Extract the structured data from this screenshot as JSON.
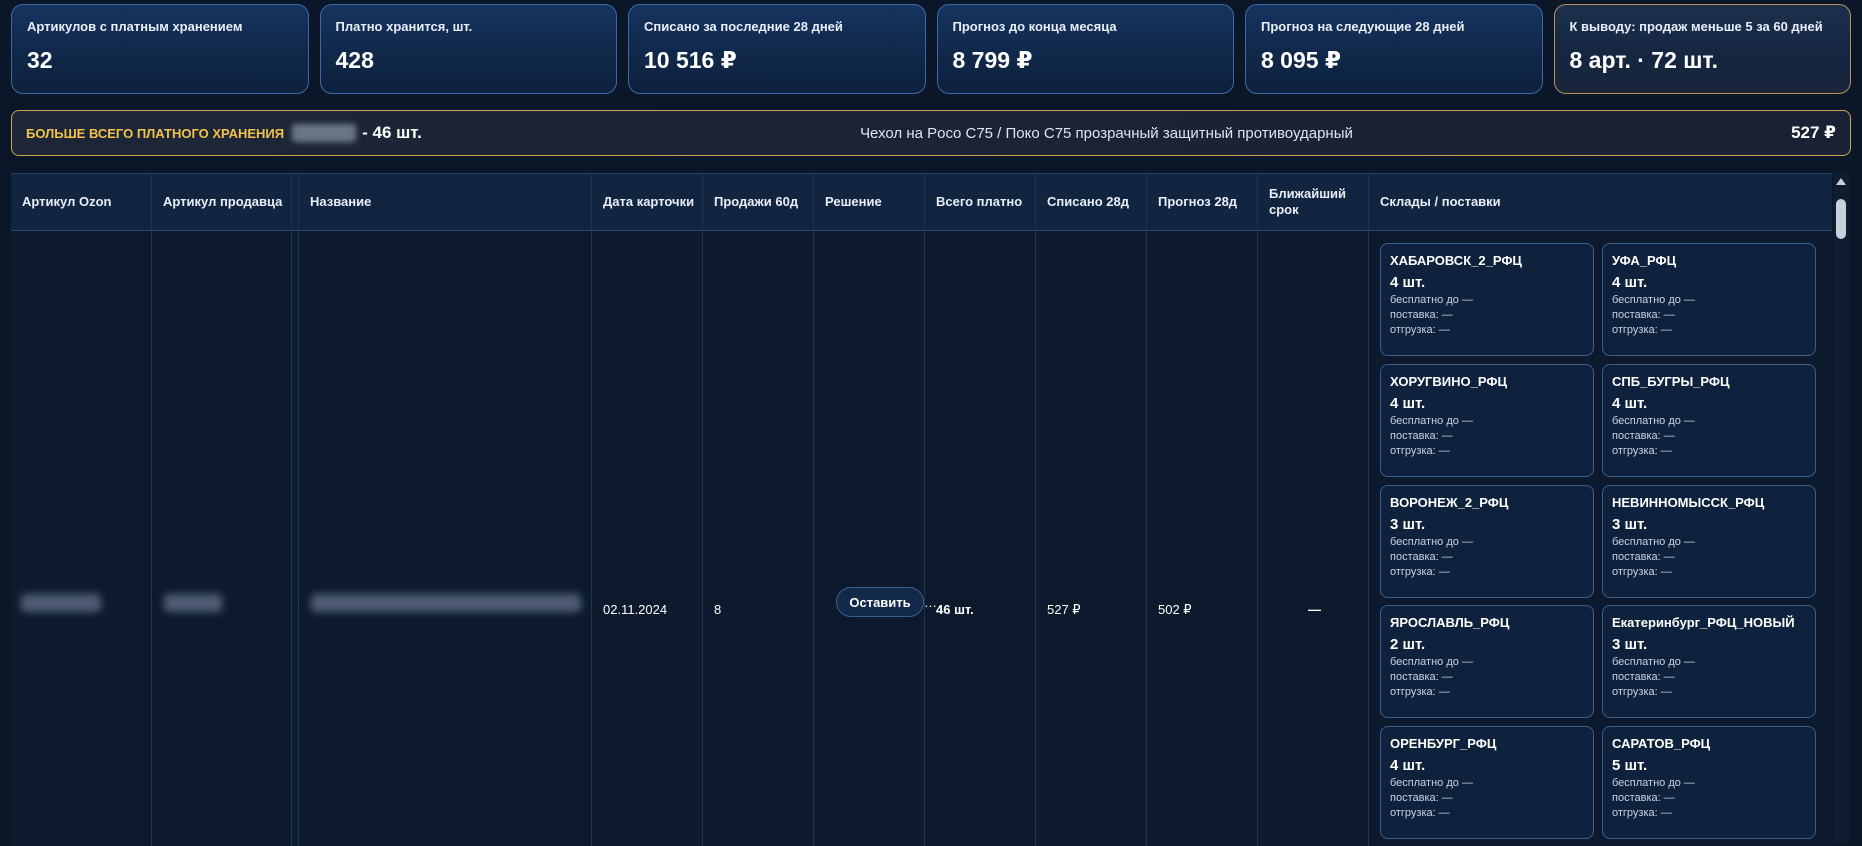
{
  "kpis": [
    {
      "label": "Артикулов с платным хранением",
      "value": "32"
    },
    {
      "label": "Платно хранится, шт.",
      "value": "428"
    },
    {
      "label": "Списано за последние 28 дней",
      "value": "10 516 ₽"
    },
    {
      "label": "Прогноз до конца месяца",
      "value": "8 799 ₽"
    },
    {
      "label": "Прогноз на следующие 28 дней",
      "value": "8 095 ₽"
    },
    {
      "label": "К выводу: продаж меньше 5 за 60 дней",
      "value": "8 арт. · 72 шт."
    }
  ],
  "banner": {
    "label": "БОЛЬШЕ ВСЕГО ПЛАТНОГО ХРАНЕНИЯ",
    "count": "- 46 шт.",
    "product": "Чехол на Poco C75 / Поко C75 прозрачный защитный противоударный",
    "price": "527 ₽"
  },
  "table": {
    "headers": {
      "ozon": "Артикул Ozon",
      "seller": "Артикул продавца",
      "name": "Название",
      "card_date": "Дата карточки",
      "sales60": "Продажи 60д",
      "decision": "Решение",
      "total_paid": "Всего платно",
      "written28": "Списано 28д",
      "forecast28": "Прогноз 28д",
      "nearest": "Ближайший срок",
      "warehouses": "Склады / поставки"
    },
    "row": {
      "card_date": "02.11.2024",
      "sales60": "8",
      "decision_button": "Оставить",
      "decision_more": "…",
      "total_paid": "46 шт.",
      "written28": "527 ₽",
      "forecast28": "502 ₽",
      "nearest": "—"
    },
    "warehouses": [
      {
        "name": "ХАБАРОВСК_2_РФЦ",
        "qty": "4 шт.",
        "free_until": "бесплатно до —",
        "supply": "поставка: —",
        "shipment": "отгрузка: —"
      },
      {
        "name": "УФА_РФЦ",
        "qty": "4 шт.",
        "free_until": "бесплатно до —",
        "supply": "поставка: —",
        "shipment": "отгрузка: —"
      },
      {
        "name": "ХОРУГВИНО_РФЦ",
        "qty": "4 шт.",
        "free_until": "бесплатно до —",
        "supply": "поставка: —",
        "shipment": "отгрузка: —"
      },
      {
        "name": "СПБ_БУГРЫ_РФЦ",
        "qty": "4 шт.",
        "free_until": "бесплатно до —",
        "supply": "поставка: —",
        "shipment": "отгрузка: —"
      },
      {
        "name": "ВОРОНЕЖ_2_РФЦ",
        "qty": "3 шт.",
        "free_until": "бесплатно до —",
        "supply": "поставка: —",
        "shipment": "отгрузка: —"
      },
      {
        "name": "НЕВИННОМЫССК_РФЦ",
        "qty": "3 шт.",
        "free_until": "бесплатно до —",
        "supply": "поставка: —",
        "shipment": "отгрузка: —"
      },
      {
        "name": "ЯРОСЛАВЛЬ_РФЦ",
        "qty": "2 шт.",
        "free_until": "бесплатно до —",
        "supply": "поставка: —",
        "shipment": "отгрузка: —"
      },
      {
        "name": "Екатеринбург_РФЦ_НОВЫЙ",
        "qty": "3 шт.",
        "free_until": "бесплатно до —",
        "supply": "поставка: —",
        "shipment": "отгрузка: —"
      },
      {
        "name": "ОРЕНБУРГ_РФЦ",
        "qty": "4 шт.",
        "free_until": "бесплатно до —",
        "supply": "поставка: —",
        "shipment": "отгрузка: —"
      },
      {
        "name": "САРАТОВ_РФЦ",
        "qty": "5 шт.",
        "free_until": "бесплатно до —",
        "supply": "поставка: —",
        "shipment": "отгрузка: —"
      }
    ]
  },
  "colors": {
    "background": "#0b1728",
    "card_border": "#3a6aa6",
    "alert_border": "#b8905a",
    "banner_accent": "#f3c24a"
  }
}
